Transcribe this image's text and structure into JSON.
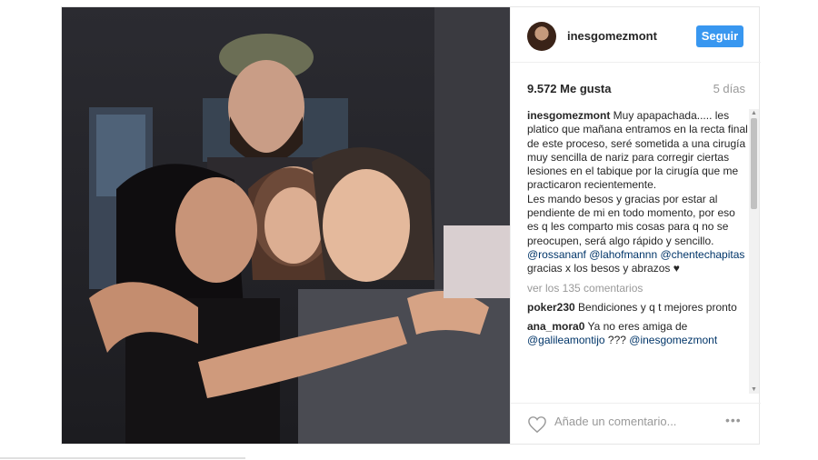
{
  "profile": {
    "username": "inesgomezmont",
    "follow_label": "Seguir"
  },
  "post": {
    "likes": "9.572 Me gusta",
    "time_ago": "5 días"
  },
  "caption": {
    "author": "inesgomezmont",
    "text1": " Muy apapachada..... les platico que mañana entramos en la recta final de este proceso, seré sometida a una cirugía muy sencilla de nariz para corregir ciertas lesiones en el tabique por la cirugía que me practicaron recientemente.",
    "text2": "Les mando besos y gracias por estar al pendiente de mi en todo momento, por eso es q les comparto mis cosas para q no se preocupen, será algo rápido y sencillo.",
    "mention1": "@rossananf",
    "mention2": "@lahofmannn",
    "mention3": "@chentechapitas",
    "text3": " gracias x los besos y abrazos ♥"
  },
  "view_comments": "ver los 135 comentarios",
  "comments": [
    {
      "user": "poker230",
      "text": " Bendiciones y q t mejores pronto"
    },
    {
      "user": "ana_mora0",
      "text": " Ya no eres amiga de ",
      "mention_a": "@galileamontijo",
      "mid": " ??? ",
      "mention_b": "@inesgomezmont"
    }
  ],
  "footer": {
    "add_comment_placeholder": "Añade un comentario...",
    "more_icon": "•••"
  },
  "icons": {
    "like": "heart-icon",
    "options": "more-options-icon"
  },
  "colors": {
    "follow_button": "#3897f0",
    "mention": "#003569",
    "muted": "#999999"
  }
}
